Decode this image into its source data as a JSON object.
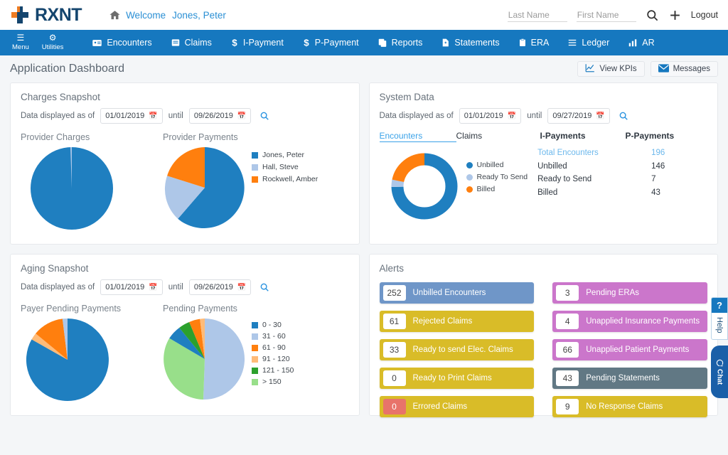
{
  "brand": {
    "name": "RXNT",
    "logo_icon": "cross-icon"
  },
  "header": {
    "home_icon": "home-icon",
    "welcome_label": "Welcome",
    "user_name": "Jones, Peter",
    "last_name_placeholder": "Last Name",
    "last_name_value": "",
    "first_name_placeholder": "First Name",
    "first_name_value": "",
    "search_icon": "search-icon",
    "add_icon": "plus-icon",
    "logout_label": "Logout"
  },
  "nav": {
    "menu_label": "Menu",
    "menu_icon": "hamburger-icon",
    "utilities_label": "Utilities",
    "utilities_icon": "gear-icon",
    "items": [
      {
        "label": "Encounters",
        "icon": "id-card-icon"
      },
      {
        "label": "Claims",
        "icon": "document-icon"
      },
      {
        "label": "I-Payment",
        "icon": "dollar-icon"
      },
      {
        "label": "P-Payment",
        "icon": "dollar-icon"
      },
      {
        "label": "Reports",
        "icon": "copy-icon"
      },
      {
        "label": "Statements",
        "icon": "file-plus-icon"
      },
      {
        "label": "ERA",
        "icon": "clipboard-icon"
      },
      {
        "label": "Ledger",
        "icon": "list-icon"
      },
      {
        "label": "AR",
        "icon": "bar-chart-icon"
      }
    ]
  },
  "page": {
    "title": "Application Dashboard",
    "view_kpis_label": "View KPIs",
    "view_kpis_icon": "line-chart-icon",
    "messages_label": "Messages",
    "messages_icon": "envelope-icon"
  },
  "charges_snapshot": {
    "title": "Charges Snapshot",
    "filter_label": "Data displayed as of",
    "from_date": "01/01/2019",
    "until_label": "until",
    "to_date": "09/26/2019",
    "calendar_icon": "calendar-icon",
    "search_icon": "search-icon"
  },
  "system_data": {
    "title": "System Data",
    "filter_label": "Data displayed as of",
    "from_date": "01/01/2019",
    "until_label": "until",
    "to_date": "09/27/2019",
    "calendar_icon": "calendar-icon",
    "search_icon": "search-icon",
    "tabs": [
      {
        "label": "Encounters",
        "active": true
      },
      {
        "label": "Claims",
        "active": false
      },
      {
        "label": "I-Payments",
        "active": false
      },
      {
        "label": "P-Payments",
        "active": false
      }
    ],
    "rows": [
      {
        "key": "Total Encounters",
        "value": "196",
        "highlight": true
      },
      {
        "key": "Unbilled",
        "value": "146",
        "highlight": false
      },
      {
        "key": "Ready to Send",
        "value": "7",
        "highlight": false
      },
      {
        "key": "Billed",
        "value": "43",
        "highlight": false
      }
    ]
  },
  "aging_snapshot": {
    "title": "Aging Snapshot",
    "filter_label": "Data displayed as of",
    "from_date": "01/01/2019",
    "until_label": "until",
    "to_date": "09/26/2019",
    "calendar_icon": "calendar-icon",
    "search_icon": "search-icon"
  },
  "alerts": {
    "title": "Alerts",
    "left": [
      {
        "count": "252",
        "label": "Unbilled Encounters",
        "color": "#6f96c8",
        "danger": false
      },
      {
        "count": "61",
        "label": "Rejected Claims",
        "color": "#d9bc28",
        "danger": false
      },
      {
        "count": "33",
        "label": "Ready to send Elec. Claims",
        "color": "#d9bc28",
        "danger": false
      },
      {
        "count": "0",
        "label": "Ready to Print Claims",
        "color": "#d9bc28",
        "danger": false
      },
      {
        "count": "0",
        "label": "Errored Claims",
        "color": "#d9bc28",
        "danger": true
      }
    ],
    "right": [
      {
        "count": "3",
        "label": "Pending ERAs",
        "color": "#cb76cb",
        "danger": false
      },
      {
        "count": "4",
        "label": "Unapplied Insurance Payments",
        "color": "#cb76cb",
        "danger": false
      },
      {
        "count": "66",
        "label": "Unapplied Patient Payments",
        "color": "#cb76cb",
        "danger": false
      },
      {
        "count": "43",
        "label": "Pending Statements",
        "color": "#617884",
        "danger": false
      },
      {
        "count": "9",
        "label": "No Response Claims",
        "color": "#d9bc28",
        "danger": false
      }
    ]
  },
  "side_widgets": {
    "help_symbol": "?",
    "help_label": "Help",
    "chat_icon": "chat-bubble-icon",
    "chat_label": "Chat"
  },
  "colors": {
    "nav_blue": "#1678bf",
    "accent_blue": "#2a8fd4",
    "brand_navy": "#14456e",
    "brand_orange": "#ef7c22",
    "series_blue": "#1f7fc0",
    "series_lightblue": "#aec7e8",
    "series_orange": "#ff7f0e",
    "series_lightorange": "#ffbb78",
    "series_green": "#2ca02c",
    "series_lightgreen": "#98df8a"
  },
  "chart_data": [
    {
      "type": "pie",
      "title": "Provider Charges",
      "panel": "Charges Snapshot",
      "categories": [
        "Jones, Peter",
        "Hall, Steve",
        "Rockwell, Amber"
      ],
      "values": [
        99.4,
        0.6,
        0
      ],
      "colors": [
        "#1f7fc0",
        "#aec7e8",
        "#ff7f0e"
      ],
      "legend": "shared-right"
    },
    {
      "type": "pie",
      "title": "Provider Payments",
      "panel": "Charges Snapshot",
      "categories": [
        "Jones, Peter",
        "Hall, Steve",
        "Rockwell, Amber"
      ],
      "values": [
        68,
        18,
        14
      ],
      "colors": [
        "#1f7fc0",
        "#aec7e8",
        "#ff7f0e"
      ],
      "legend": "right"
    },
    {
      "type": "pie",
      "title": "Encounters",
      "panel": "System Data",
      "donut": true,
      "categories": [
        "Unbilled",
        "Ready To Send",
        "Billed"
      ],
      "values": [
        146,
        7,
        43
      ],
      "colors": [
        "#1f7fc0",
        "#aec7e8",
        "#ff7f0e"
      ],
      "legend": "right"
    },
    {
      "type": "pie",
      "title": "Payer Pending Payments",
      "panel": "Aging Snapshot",
      "categories": [
        "0 - 30",
        "31 - 60",
        "61 - 90",
        "91 - 120",
        "121 - 150",
        "> 150"
      ],
      "values": [
        85,
        2,
        11.5,
        1.5,
        0,
        0
      ],
      "colors": [
        "#1f7fc0",
        "#aec7e8",
        "#ff7f0e",
        "#ffbb78",
        "#2ca02c",
        "#98df8a"
      ],
      "legend": "shared-right"
    },
    {
      "type": "pie",
      "title": "Pending Payments",
      "panel": "Aging Snapshot",
      "categories": [
        "0 - 30",
        "31 - 60",
        "61 - 90",
        "91 - 120",
        "121 - 150",
        "> 150"
      ],
      "values": [
        10,
        48,
        5,
        2,
        7,
        28
      ],
      "colors": [
        "#1f7fc0",
        "#aec7e8",
        "#ff7f0e",
        "#ffbb78",
        "#2ca02c",
        "#98df8a"
      ],
      "legend": "right"
    }
  ]
}
